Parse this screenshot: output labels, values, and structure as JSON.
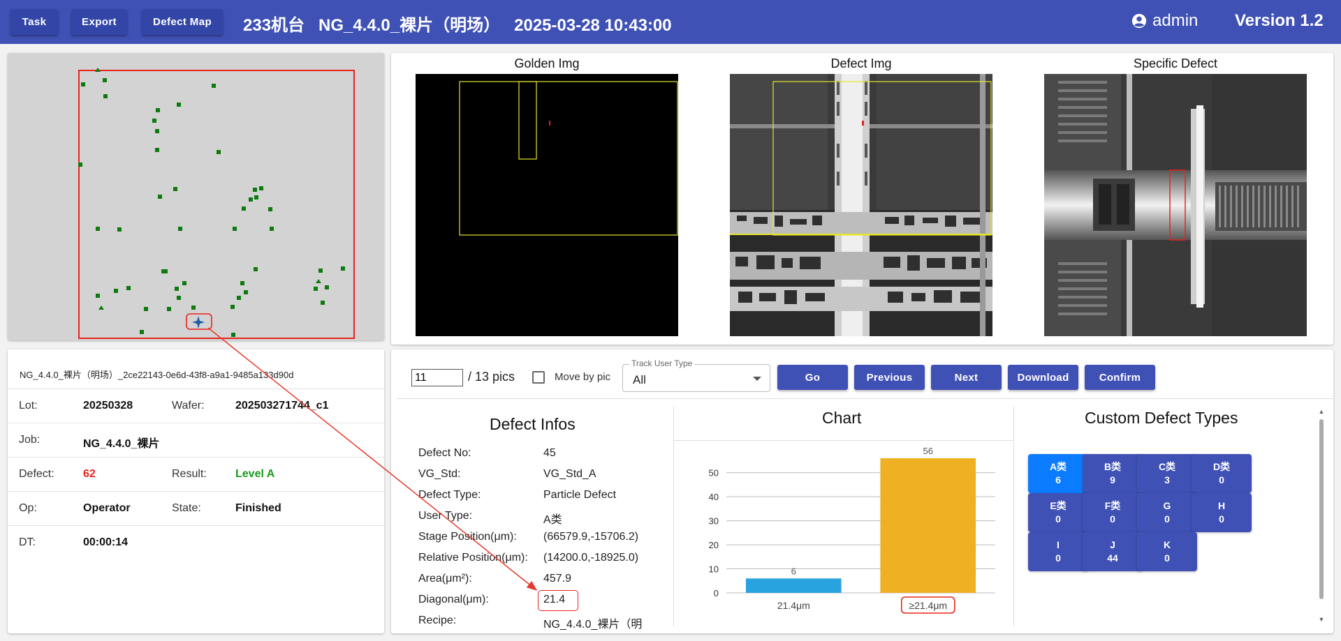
{
  "topbar": {
    "task_label": "Task",
    "export_label": "Export",
    "defect_map_label": "Defect Map",
    "title": "233机台   NG_4.4.0_裸片（明场）   2025-03-28 10:43:00",
    "user": "admin",
    "version": "Version 1.2"
  },
  "images": {
    "golden_title": "Golden Img",
    "defect_title": "Defect Img",
    "specific_title": "Specific Defect"
  },
  "info": {
    "uuid": "NG_4.4.0_裸片（明场）_2ce22143-0e6d-43f8-a9a1-9485a133d90d",
    "lot_label": "Lot:",
    "lot": "20250328",
    "wafer_label": "Wafer:",
    "wafer": "202503271744_c1",
    "job_label": "Job:",
    "job": "NG_4.4.0_裸片",
    "defect_label": "Defect:",
    "defect": "62",
    "result_label": "Result:",
    "result": "Level A",
    "op_label": "Op:",
    "op": "Operator",
    "state_label": "State:",
    "state": "Finished",
    "dt_label": "DT:",
    "dt": "00:00:14"
  },
  "controls": {
    "pic_value": "11",
    "pic_total": "/ 13 pics",
    "move_by_pic": "Move by pic",
    "track_user_type_label": "Track User Type",
    "track_user_type_value": "All",
    "go": "Go",
    "previous": "Previous",
    "next": "Next",
    "download": "Download",
    "confirm": "Confirm"
  },
  "defect_infos": {
    "title": "Defect Infos",
    "rows": [
      {
        "label": "Defect No:",
        "value": "45"
      },
      {
        "label": "VG_Std:",
        "value": "VG_Std_A"
      },
      {
        "label": "Defect Type:",
        "value": "Particle Defect"
      },
      {
        "label": "User Type:",
        "value": "A类"
      },
      {
        "label": "Stage Position(μm):",
        "value": "(66579.9,-15706.2)"
      },
      {
        "label": "Relative Position(μm):",
        "value": "(14200.0,-18925.0)"
      },
      {
        "label": "Area(μm²):",
        "value": "457.9"
      },
      {
        "label": "Diagonal(μm):",
        "value": "21.4"
      },
      {
        "label": "Recipe:",
        "value": "NG_4.4.0_裸片（明"
      }
    ]
  },
  "chart_panel_title": "Chart",
  "chart_data": {
    "type": "bar",
    "categories": [
      "21.4μm",
      "≥21.4μm"
    ],
    "values": [
      6,
      56
    ],
    "colors": [
      "#29a3e0",
      "#f0b023"
    ],
    "ylim": [
      0,
      56
    ],
    "yticks": [
      0,
      10,
      20,
      30,
      40,
      50
    ],
    "grid": true
  },
  "custom_types": {
    "title": "Custom Defect Types",
    "items": [
      {
        "name": "A类",
        "count": "6",
        "active": true
      },
      {
        "name": "B类",
        "count": "9"
      },
      {
        "name": "C类",
        "count": "3"
      },
      {
        "name": "D类",
        "count": "0"
      },
      {
        "name": "E类",
        "count": "0"
      },
      {
        "name": "F类",
        "count": "0"
      },
      {
        "name": "G",
        "count": "0"
      },
      {
        "name": "H",
        "count": "0"
      },
      {
        "name": "I",
        "count": "0"
      },
      {
        "name": "J",
        "count": "44"
      },
      {
        "name": "K",
        "count": "0"
      }
    ]
  },
  "colors": {
    "primary": "#3f51b5",
    "active": "#0b7cff",
    "defect_count": "#e8231c",
    "result": "#1a9a1a",
    "wafer_die": "#0d7a0d",
    "highlight_red": "#e53a2a"
  }
}
